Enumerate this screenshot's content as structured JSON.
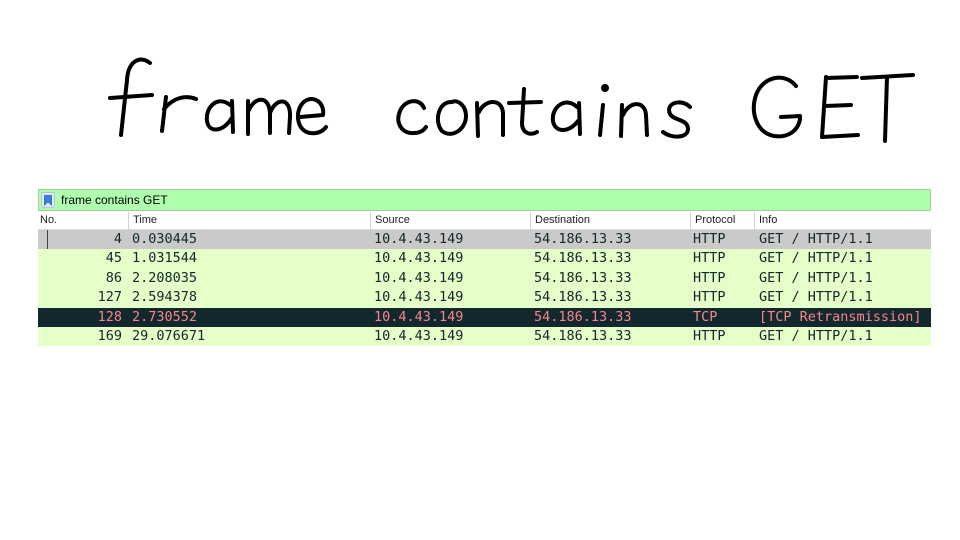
{
  "caption": {
    "text": "frame contains GET"
  },
  "filter": {
    "icon": "bookmark-icon",
    "value": "frame contains GET",
    "bg_color": "#afffaf"
  },
  "columns": {
    "no": "No.",
    "time": "Time",
    "source": "Source",
    "destination": "Destination",
    "protocol": "Protocol",
    "info": "Info"
  },
  "packets": [
    {
      "no": "4",
      "time": "0.030445",
      "source": "10.4.43.149",
      "destination": "54.186.13.33",
      "protocol": "HTTP",
      "info": "GET / HTTP/1.1",
      "style": "selected-gray"
    },
    {
      "no": "45",
      "time": "1.031544",
      "source": "10.4.43.149",
      "destination": "54.186.13.33",
      "protocol": "HTTP",
      "info": "GET / HTTP/1.1",
      "style": "http"
    },
    {
      "no": "86",
      "time": "2.208035",
      "source": "10.4.43.149",
      "destination": "54.186.13.33",
      "protocol": "HTTP",
      "info": "GET / HTTP/1.1",
      "style": "http"
    },
    {
      "no": "127",
      "time": "2.594378",
      "source": "10.4.43.149",
      "destination": "54.186.13.33",
      "protocol": "HTTP",
      "info": "GET / HTTP/1.1",
      "style": "http"
    },
    {
      "no": "128",
      "time": "2.730552",
      "source": "10.4.43.149",
      "destination": "54.186.13.33",
      "protocol": "TCP",
      "info": "[TCP Retransmission]",
      "style": "tcp-issue"
    },
    {
      "no": "169",
      "time": "29.076671",
      "source": "10.4.43.149",
      "destination": "54.186.13.33",
      "protocol": "HTTP",
      "info": "GET / HTTP/1.1",
      "style": "http"
    }
  ],
  "colors": {
    "http_row": "#e4ffc7",
    "selected_row": "#cacaca",
    "tcp_issue_bg": "#12272e",
    "tcp_issue_fg": "#f78787"
  }
}
